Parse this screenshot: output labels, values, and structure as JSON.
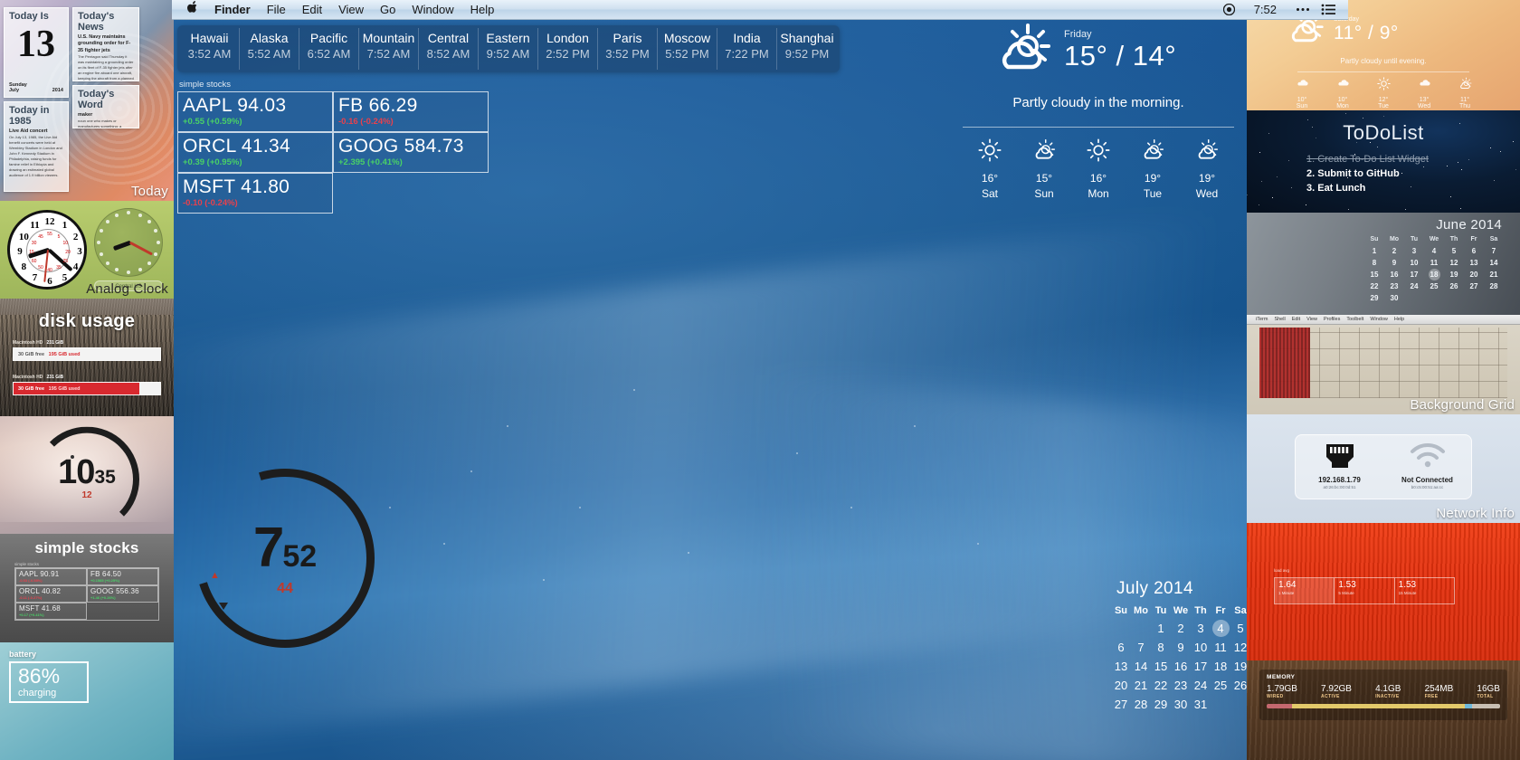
{
  "menubar": {
    "apple_icon": "apple-logo-icon",
    "items": [
      "Finder",
      "File",
      "Edit",
      "View",
      "Go",
      "Window",
      "Help"
    ],
    "right": {
      "record_icon": "record-circle-icon",
      "time": "7:52",
      "dots_icon": "ellipsis-icon",
      "list_icon": "list-icon"
    }
  },
  "timezones": {
    "zones": [
      {
        "city": "Hawaii",
        "time": "3:52 AM"
      },
      {
        "city": "Alaska",
        "time": "5:52 AM"
      },
      {
        "city": "Pacific",
        "time": "6:52 AM"
      },
      {
        "city": "Mountain",
        "time": "7:52 AM"
      },
      {
        "city": "Central",
        "time": "8:52 AM"
      },
      {
        "city": "Eastern",
        "time": "9:52 AM"
      },
      {
        "city": "London",
        "time": "2:52 PM"
      },
      {
        "city": "Paris",
        "time": "3:52 PM"
      },
      {
        "city": "Moscow",
        "time": "5:52 PM"
      },
      {
        "city": "India",
        "time": "7:22 PM"
      },
      {
        "city": "Shanghai",
        "time": "9:52 PM"
      }
    ]
  },
  "stocks_desktop": {
    "caption": "simple stocks",
    "rows": [
      [
        {
          "symbol": "AAPL 94.03",
          "change": "+0.55 (+0.59%)",
          "dir": "up"
        },
        {
          "symbol": "FB 66.29",
          "change": "-0.16 (-0.24%)",
          "dir": "down"
        }
      ],
      [
        {
          "symbol": "ORCL 41.34",
          "change": "+0.39 (+0.95%)",
          "dir": "up"
        },
        {
          "symbol": "GOOG 584.73",
          "change": "+2.395 (+0.41%)",
          "dir": "up"
        }
      ],
      [
        {
          "symbol": "MSFT 41.80",
          "change": "-0.10 (-0.24%)",
          "dir": "down"
        },
        {
          "symbol": "",
          "change": "",
          "dir": "none"
        }
      ]
    ]
  },
  "weather_main": {
    "icon": "sun-behind-cloud-icon",
    "day": "Friday",
    "temp": "15° / 14°",
    "description": "Partly cloudy in the morning.",
    "forecast": [
      {
        "icon": "sun-icon",
        "temp": "16°",
        "day": "Sat"
      },
      {
        "icon": "sun-behind-cloud-icon",
        "temp": "15°",
        "day": "Sun"
      },
      {
        "icon": "sun-icon",
        "temp": "16°",
        "day": "Mon"
      },
      {
        "icon": "sun-behind-cloud-icon",
        "temp": "19°",
        "day": "Tue"
      },
      {
        "icon": "sun-behind-cloud-icon",
        "temp": "19°",
        "day": "Wed"
      }
    ]
  },
  "bigclock": {
    "hours": "7",
    "minutes": "52",
    "seconds": "44"
  },
  "calendar_july": {
    "title": "July 2014",
    "dow": [
      "Su",
      "Mo",
      "Tu",
      "We",
      "Th",
      "Fr",
      "Sa"
    ],
    "weeks": [
      [
        "",
        "",
        "1",
        "2",
        "3",
        "4",
        "5"
      ],
      [
        "6",
        "7",
        "8",
        "9",
        "10",
        "11",
        "12"
      ],
      [
        "13",
        "14",
        "15",
        "16",
        "17",
        "18",
        "19"
      ],
      [
        "20",
        "21",
        "22",
        "23",
        "24",
        "25",
        "26"
      ],
      [
        "27",
        "28",
        "29",
        "30",
        "31",
        "",
        ""
      ]
    ],
    "today": "4"
  },
  "sidebar_left": {
    "today_widget": {
      "label": "Today",
      "today_is_title": "Today Is",
      "day_number": "13",
      "weekday": "Sunday",
      "month": "July",
      "year": "2014",
      "news_title": "Today's News",
      "news_headline": "U.S. Navy maintains grounding order for F-35 fighter jets",
      "news_body": "The Pentagon said Thursday it was maintaining a grounding order on its fleet of F-35 fighter jets after an engine fire aboard one aircraft, keeping the aircraft from a planned international debut at air shows in Britain this month.",
      "word_title": "Today's Word",
      "word": "maker",
      "word_def": "noun  one who makes or manufactures something; a creator.",
      "history_title": "Today in 1985",
      "history_headline": "Live Aid concert",
      "history_body": "On July 13, 1985, the Live Aid benefit concerts were held at Wembley Stadium in London and John F. Kennedy Stadium in Philadelphia, raising funds for famine relief in Ethiopia and drawing an estimated global audience of 1.9 billion viewers."
    },
    "clock_widget": {
      "label": "Analog Clock",
      "timezone_label": "Central US",
      "numerals": [
        "12",
        "1",
        "2",
        "3",
        "4",
        "5",
        "6",
        "7",
        "8",
        "9",
        "10",
        "11"
      ]
    },
    "disk_widget": {
      "title": "disk usage",
      "volumes": [
        {
          "name": "Macintosh HD",
          "size": "231 GiB",
          "free": "30 GiB free",
          "used": "195 GiB used",
          "pct": 86
        },
        {
          "name": "Macintosh HD",
          "size": "231 GiB",
          "free": "30 GiB free",
          "used": "195 GiB used",
          "pct": 86
        }
      ]
    },
    "ring_clock": {
      "hours": "10",
      "minutes": "35",
      "seconds": "12"
    },
    "stocks_widget": {
      "title": "simple stocks",
      "caption": "simple stocks",
      "rows": [
        [
          {
            "symbol": "AAPL 90.91",
            "change": "-0.53 (-0.58%)",
            "dir": "down"
          },
          {
            "symbol": "FB 64.50",
            "change": "+0.1585 (+0.25%)",
            "dir": "up"
          }
        ],
        [
          {
            "symbol": "ORCL 40.82",
            "change": "-0.11 (-0.27%)",
            "dir": "down"
          },
          {
            "symbol": "GOOG 556.36",
            "change": "+1.46 (+0.26%)",
            "dir": "up"
          }
        ],
        [
          {
            "symbol": "MSFT 41.68",
            "change": "+0.17 (+0.41%)",
            "dir": "up"
          },
          {
            "symbol": "",
            "change": "",
            "dir": "none"
          }
        ]
      ]
    },
    "battery_widget": {
      "caption": "battery",
      "percent": "86%",
      "state": "charging"
    }
  },
  "sidebar_right": {
    "weather_widget": {
      "icon": "sun-behind-cloud-icon",
      "day": "Saturday",
      "temp": "11° / 9°",
      "description": "Partly cloudy until evening.",
      "forecast": [
        {
          "icon": "cloud-icon",
          "temp": "10°",
          "day": "Sun"
        },
        {
          "icon": "cloud-icon",
          "temp": "10°",
          "day": "Mon"
        },
        {
          "icon": "sun-icon",
          "temp": "12°",
          "day": "Tue"
        },
        {
          "icon": "cloud-icon",
          "temp": "13°",
          "day": "Wed"
        },
        {
          "icon": "sun-behind-cloud-icon",
          "temp": "11°",
          "day": "Thu"
        }
      ]
    },
    "todo_widget": {
      "title": "ToDoList",
      "items": [
        {
          "text": "1. Create To-Do List Widget",
          "done": true
        },
        {
          "text": "2. Submit to GitHub",
          "done": false
        },
        {
          "text": "3. Eat Lunch",
          "done": false
        }
      ]
    },
    "calendar_june": {
      "title": "June 2014",
      "dow": [
        "Su",
        "Mo",
        "Tu",
        "We",
        "Th",
        "Fr",
        "Sa"
      ],
      "weeks": [
        [
          "1",
          "2",
          "3",
          "4",
          "5",
          "6",
          "7"
        ],
        [
          "8",
          "9",
          "10",
          "11",
          "12",
          "13",
          "14"
        ],
        [
          "15",
          "16",
          "17",
          "18",
          "19",
          "20",
          "21"
        ],
        [
          "22",
          "23",
          "24",
          "25",
          "26",
          "27",
          "28"
        ],
        [
          "29",
          "30",
          "",
          "",
          "",
          "",
          ""
        ]
      ],
      "today": "18"
    },
    "grid_widget": {
      "label": "Background Grid",
      "menu": [
        "iTerm",
        "Shell",
        "Edit",
        "View",
        "Profiles",
        "Toolbelt",
        "Window",
        "Help"
      ]
    },
    "network_widget": {
      "label": "Network Info",
      "ethernet": {
        "icon": "ethernet-port-icon",
        "value": "192.168.1.79",
        "mac": "a0:26:bc:00:0d:51"
      },
      "wifi": {
        "icon": "wifi-icon",
        "value": "Not Connected",
        "mac": "b0:c5:00:51:aa:cc"
      }
    },
    "load_widget": {
      "caption": "load avg",
      "entries": [
        {
          "value": "1.64",
          "period": "1 Minute"
        },
        {
          "value": "1.53",
          "period": "5 Minute"
        },
        {
          "value": "1.53",
          "period": "15 Minute"
        }
      ]
    },
    "memory_widget": {
      "caption": "MEMORY",
      "entries": [
        {
          "value": "1.79GB",
          "label": "WIRED",
          "color": "#c4686e"
        },
        {
          "value": "7.92GB",
          "label": "ACTIVE",
          "color": "#e3c96a"
        },
        {
          "value": "4.1GB",
          "label": "INACTIVE",
          "color": "#e3c96a"
        },
        {
          "value": "254MB",
          "label": "FREE",
          "color": "#6fb8da"
        },
        {
          "value": "16GB",
          "label": "TOTAL",
          "color": "#c9bfb3"
        }
      ]
    }
  }
}
